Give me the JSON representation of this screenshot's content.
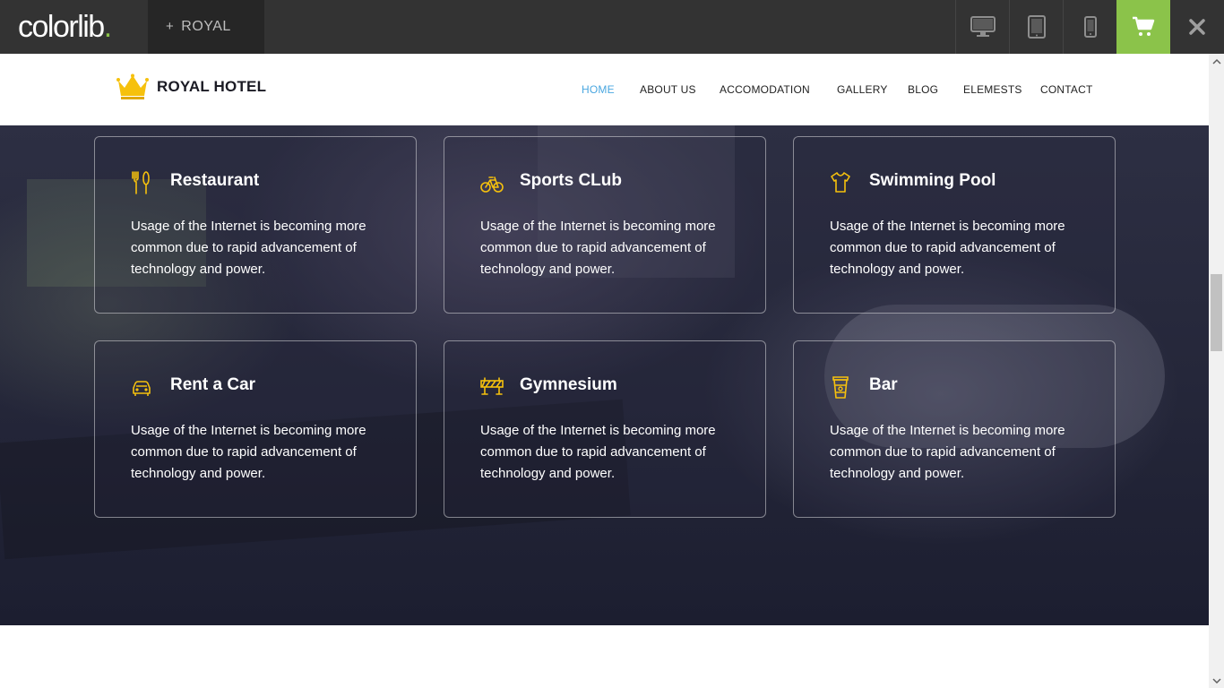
{
  "preview_bar": {
    "brand": "colorlib",
    "brand_dot": ".",
    "theme_plus": "+",
    "theme_name": "ROYAL",
    "devices": [
      "desktop-icon",
      "tablet-icon",
      "mobile-icon"
    ],
    "cart_icon": "cart-icon",
    "close_icon": "close-icon",
    "accent_color": "#8bc34a"
  },
  "site": {
    "logo_text": "ROYAL HOTEL",
    "logo_icon": "crown-icon",
    "nav": [
      {
        "label": "HOME",
        "active": true
      },
      {
        "label": "ABOUT US",
        "active": false
      },
      {
        "label": "ACCOMODATION",
        "active": false
      },
      {
        "label": "GALLERY",
        "active": false
      },
      {
        "label": "BLOG",
        "active": false
      },
      {
        "label": "ELEMESTS",
        "active": false
      },
      {
        "label": "CONTACT",
        "active": false
      }
    ],
    "active_color": "#4aa7e0",
    "icon_color": "#f6c10d"
  },
  "services": [
    {
      "icon": "restaurant-icon",
      "title": "Restaurant",
      "text": "Usage of the Internet is becoming more common due to rapid advancement of technology and power."
    },
    {
      "icon": "bicycle-icon",
      "title": "Sports CLub",
      "text": "Usage of the Internet is becoming more common due to rapid advancement of technology and power."
    },
    {
      "icon": "shirt-icon",
      "title": "Swimming Pool",
      "text": "Usage of the Internet is becoming more common due to rapid advancement of technology and power."
    },
    {
      "icon": "car-icon",
      "title": "Rent a Car",
      "text": "Usage of the Internet is becoming more common due to rapid advancement of technology and power."
    },
    {
      "icon": "barrier-icon",
      "title": "Gymnesium",
      "text": "Usage of the Internet is becoming more common due to rapid advancement of technology and power."
    },
    {
      "icon": "cup-icon",
      "title": "Bar",
      "text": "Usage of the Internet is becoming more common due to rapid advancement of technology and power."
    }
  ]
}
